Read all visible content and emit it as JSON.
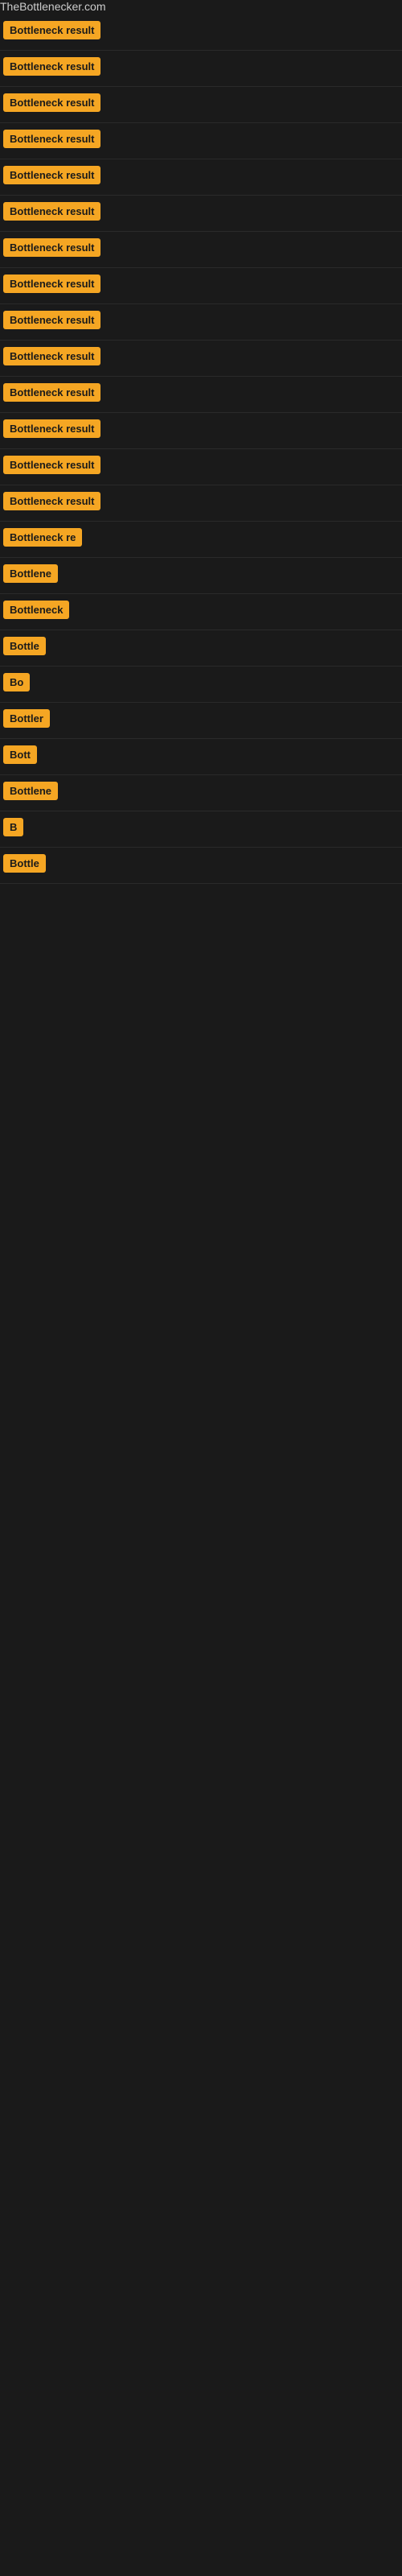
{
  "site": {
    "title": "TheBottlenecker.com"
  },
  "results": [
    {
      "id": 1,
      "label": "Bottleneck result",
      "visible_text": "Bottleneck result"
    },
    {
      "id": 2,
      "label": "Bottleneck result",
      "visible_text": "Bottleneck result"
    },
    {
      "id": 3,
      "label": "Bottleneck result",
      "visible_text": "Bottleneck result"
    },
    {
      "id": 4,
      "label": "Bottleneck result",
      "visible_text": "Bottleneck result"
    },
    {
      "id": 5,
      "label": "Bottleneck result",
      "visible_text": "Bottleneck result"
    },
    {
      "id": 6,
      "label": "Bottleneck result",
      "visible_text": "Bottleneck result"
    },
    {
      "id": 7,
      "label": "Bottleneck result",
      "visible_text": "Bottleneck result"
    },
    {
      "id": 8,
      "label": "Bottleneck result",
      "visible_text": "Bottleneck result"
    },
    {
      "id": 9,
      "label": "Bottleneck result",
      "visible_text": "Bottleneck result"
    },
    {
      "id": 10,
      "label": "Bottleneck result",
      "visible_text": "Bottleneck result"
    },
    {
      "id": 11,
      "label": "Bottleneck result",
      "visible_text": "Bottleneck result"
    },
    {
      "id": 12,
      "label": "Bottleneck result",
      "visible_text": "Bottleneck result"
    },
    {
      "id": 13,
      "label": "Bottleneck result",
      "visible_text": "Bottleneck result"
    },
    {
      "id": 14,
      "label": "Bottleneck result",
      "visible_text": "Bottleneck result"
    },
    {
      "id": 15,
      "label": "Bottleneck re",
      "visible_text": "Bottleneck re"
    },
    {
      "id": 16,
      "label": "Bottlene",
      "visible_text": "Bottlene"
    },
    {
      "id": 17,
      "label": "Bottleneck",
      "visible_text": "Bottleneck"
    },
    {
      "id": 18,
      "label": "Bottle",
      "visible_text": "Bottle"
    },
    {
      "id": 19,
      "label": "Bo",
      "visible_text": "Bo"
    },
    {
      "id": 20,
      "label": "Bottler",
      "visible_text": "Bottler"
    },
    {
      "id": 21,
      "label": "Bott",
      "visible_text": "Bott"
    },
    {
      "id": 22,
      "label": "Bottlene",
      "visible_text": "Bottlene"
    },
    {
      "id": 23,
      "label": "B",
      "visible_text": "B"
    },
    {
      "id": 24,
      "label": "Bottle",
      "visible_text": "Bottle"
    }
  ],
  "colors": {
    "badge_bg": "#f5a623",
    "badge_text": "#1a1a1a",
    "page_bg": "#1a1a1a",
    "site_title": "#cccccc"
  }
}
